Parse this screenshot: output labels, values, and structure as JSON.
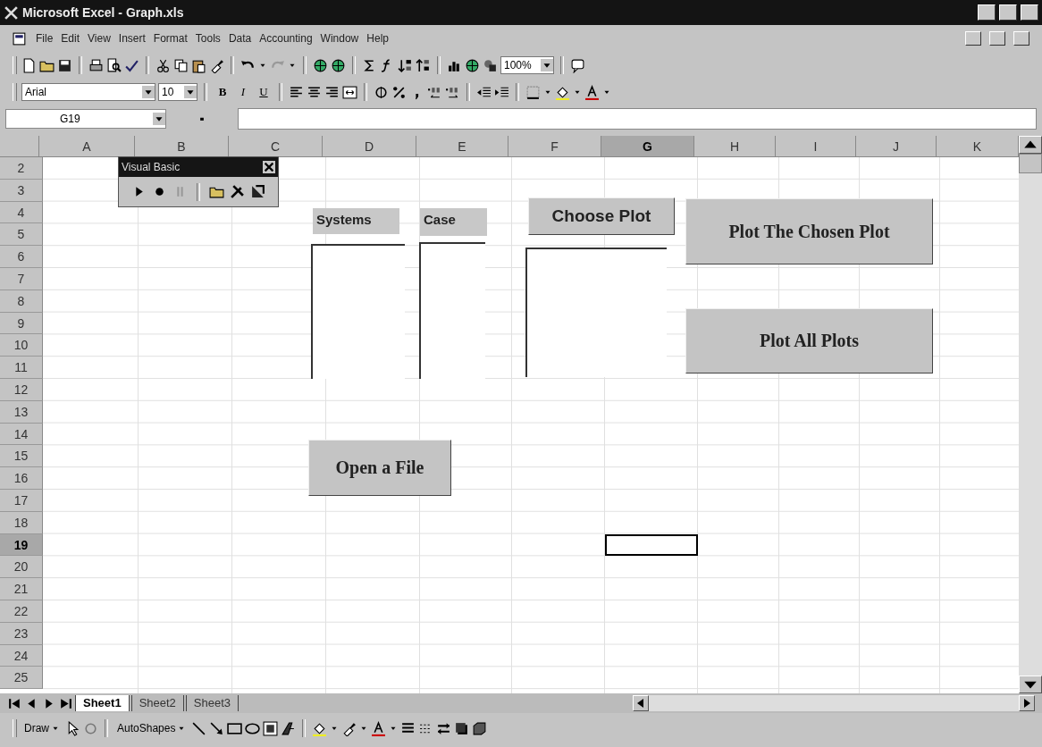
{
  "window": {
    "title": "Microsoft Excel - Graph.xls"
  },
  "menu": [
    "File",
    "Edit",
    "View",
    "Insert",
    "Format",
    "Tools",
    "Data",
    "Accounting",
    "Window",
    "Help"
  ],
  "zoom": "100%",
  "formatting": {
    "font": "Arial",
    "size": "10",
    "style_buttons": [
      "B",
      "I",
      "U"
    ]
  },
  "name_box": "G19",
  "columns": [
    {
      "label": "A",
      "selected": false
    },
    {
      "label": "B",
      "selected": false
    },
    {
      "label": "C",
      "selected": false
    },
    {
      "label": "D",
      "selected": false
    },
    {
      "label": "E",
      "selected": false
    },
    {
      "label": "F",
      "selected": false
    },
    {
      "label": "G",
      "selected": true
    },
    {
      "label": "H",
      "selected": false
    },
    {
      "label": "I",
      "selected": false
    },
    {
      "label": "J",
      "selected": false
    },
    {
      "label": "K",
      "selected": false
    }
  ],
  "rows": [
    {
      "label": "2",
      "selected": false
    },
    {
      "label": "3",
      "selected": false
    },
    {
      "label": "4",
      "selected": false
    },
    {
      "label": "5",
      "selected": false
    },
    {
      "label": "6",
      "selected": false
    },
    {
      "label": "7",
      "selected": false
    },
    {
      "label": "8",
      "selected": false
    },
    {
      "label": "9",
      "selected": false
    },
    {
      "label": "10",
      "selected": false
    },
    {
      "label": "11",
      "selected": false
    },
    {
      "label": "12",
      "selected": false
    },
    {
      "label": "13",
      "selected": false
    },
    {
      "label": "14",
      "selected": false
    },
    {
      "label": "15",
      "selected": false
    },
    {
      "label": "16",
      "selected": false
    },
    {
      "label": "17",
      "selected": false
    },
    {
      "label": "18",
      "selected": false
    },
    {
      "label": "19",
      "selected": true
    },
    {
      "label": "20",
      "selected": false
    },
    {
      "label": "21",
      "selected": false
    },
    {
      "label": "22",
      "selected": false
    },
    {
      "label": "23",
      "selected": false
    },
    {
      "label": "24",
      "selected": false
    },
    {
      "label": "25",
      "selected": false
    }
  ],
  "sheet_objects": [
    {
      "kind": "vba_toolbar",
      "title": "Visual Basic"
    },
    {
      "kind": "label",
      "text": "Systems"
    },
    {
      "kind": "label",
      "text": "Case"
    },
    {
      "kind": "button",
      "text": "Choose Plot"
    },
    {
      "kind": "button",
      "text": "Plot The Chosen Plot"
    },
    {
      "kind": "listbox"
    },
    {
      "kind": "listbox"
    },
    {
      "kind": "listbox"
    },
    {
      "kind": "button",
      "text": "Plot All Plots"
    },
    {
      "kind": "button",
      "text": "Open a File"
    }
  ],
  "sheet_tabs": [
    {
      "label": "Sheet1",
      "selected": true
    },
    {
      "label": "Sheet2",
      "selected": false
    },
    {
      "label": "Sheet3",
      "selected": false
    }
  ],
  "draw_toolbar": {
    "draw": "Draw",
    "autoshapes": "AutoShapes"
  }
}
